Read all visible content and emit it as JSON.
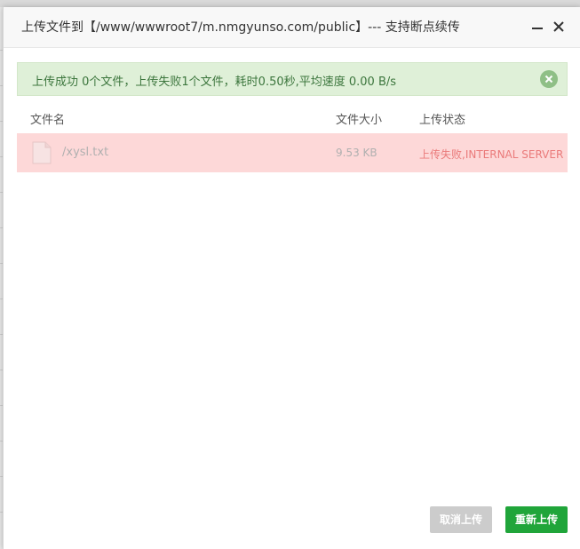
{
  "dialog": {
    "title": "上传文件到【/www/wwwroot7/m.nmgyunso.com/public】--- 支持断点续传"
  },
  "alert": {
    "message": "上传成功 0个文件，上传失败1个文件，耗时0.50秒,平均速度 0.00 B/s"
  },
  "table": {
    "headers": {
      "name": "文件名",
      "size": "文件大小",
      "status": "上传状态"
    },
    "rows": [
      {
        "name": "/xysl.txt",
        "size": "9.53 KB",
        "status": "上传失败,INTERNAL SERVER ERROR"
      }
    ]
  },
  "buttons": {
    "cancel": "取消上传",
    "retry": "重新上传"
  },
  "colors": {
    "success_bg": "#dff0d8",
    "success_text": "#3c763d",
    "error_row_bg": "#fdd8d8",
    "error_text": "#ea7a7a",
    "primary_green": "#20a53a",
    "disabled_gray": "#cccccc"
  },
  "icons": {
    "minimize": "minimize-icon",
    "close": "close-icon",
    "alert_close": "circle-close-icon",
    "file": "file-icon"
  }
}
